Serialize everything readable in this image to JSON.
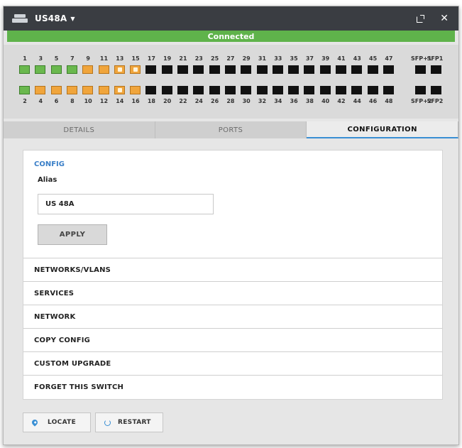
{
  "titlebar": {
    "device_name": "US48A",
    "caret": "▼",
    "close": "✕"
  },
  "status": {
    "text": "Connected"
  },
  "ports": {
    "top_labels": [
      "1",
      "3",
      "5",
      "7",
      "9",
      "11",
      "13",
      "15",
      "17",
      "19",
      "21",
      "23",
      "25",
      "27",
      "29",
      "31",
      "33",
      "35",
      "37",
      "39",
      "41",
      "43",
      "45",
      "47"
    ],
    "bottom_labels": [
      "2",
      "4",
      "6",
      "8",
      "10",
      "12",
      "14",
      "16",
      "18",
      "20",
      "22",
      "24",
      "26",
      "28",
      "30",
      "32",
      "34",
      "36",
      "38",
      "40",
      "42",
      "44",
      "46",
      "48"
    ],
    "top_states": [
      "green",
      "green",
      "green",
      "green",
      "orange",
      "orange",
      "orange-active",
      "orange-active",
      "black",
      "black",
      "black",
      "black",
      "black",
      "black",
      "black",
      "black",
      "black",
      "black",
      "black",
      "black",
      "black",
      "black",
      "black",
      "black"
    ],
    "bottom_states": [
      "green",
      "orange",
      "orange",
      "orange",
      "orange",
      "orange",
      "orange-active",
      "orange",
      "black",
      "black",
      "black",
      "black",
      "black",
      "black",
      "black",
      "black",
      "black",
      "black",
      "black",
      "black",
      "black",
      "black",
      "black",
      "black"
    ],
    "sfp_top_labels": [
      "SFP+1",
      "SFP1"
    ],
    "sfp_bottom_labels": [
      "SFP+2",
      "SFP2"
    ]
  },
  "tabs": [
    {
      "label": "DETAILS",
      "active": false
    },
    {
      "label": "PORTS",
      "active": false
    },
    {
      "label": "CONFIGURATION",
      "active": true
    }
  ],
  "config": {
    "heading": "CONFIG",
    "alias_label": "Alias",
    "alias_value": "US 48A",
    "apply_label": "APPLY"
  },
  "sections": [
    "NETWORKS/VLANS",
    "SERVICES",
    "NETWORK",
    "COPY CONFIG",
    "CUSTOM UPGRADE",
    "FORGET THIS SWITCH"
  ],
  "actions": {
    "locate_label": "LOCATE",
    "restart_label": "RESTART"
  },
  "colors": {
    "connected": "#5fb34b",
    "accent": "#3a8fd4",
    "port_green": "#6ab84e",
    "port_orange": "#f0a53c"
  }
}
